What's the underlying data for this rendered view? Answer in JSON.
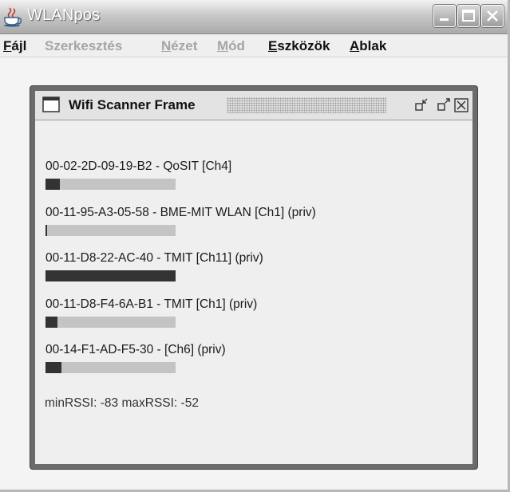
{
  "app": {
    "title": "WLANpos",
    "icon": "coffee-cup-icon",
    "window_buttons": [
      "minimize-icon",
      "maximize-icon",
      "close-icon"
    ]
  },
  "menu": [
    {
      "mnemonic": "F",
      "rest": "ájl",
      "enabled": true
    },
    {
      "mnemonic": "",
      "rest": "Szerkesztés",
      "enabled": false
    },
    {
      "mnemonic": "N",
      "rest": "ézet",
      "enabled": false
    },
    {
      "mnemonic": "M",
      "rest": "ód",
      "enabled": false
    },
    {
      "mnemonic": "E",
      "rest": "szközök",
      "enabled": true
    },
    {
      "mnemonic": "A",
      "rest": "blak",
      "enabled": true
    }
  ],
  "frame": {
    "title": "Wifi Scanner Frame",
    "controls": [
      "iconify-icon",
      "maximize-icon",
      "close-icon"
    ]
  },
  "networks": [
    {
      "label": "00-02-2D-09-19-B2 - QoSIT [Ch4]",
      "signal_fraction": 0.11
    },
    {
      "label": "00-11-95-A3-05-58 - BME-MIT WLAN [Ch1] (priv)",
      "signal_fraction": 0.01
    },
    {
      "label": "00-11-D8-22-AC-40 - TMIT [Ch11] (priv)",
      "signal_fraction": 1.0
    },
    {
      "label": "00-11-D8-F4-6A-B1 - TMIT [Ch1] (priv)",
      "signal_fraction": 0.09
    },
    {
      "label": "00-14-F1-AD-F5-30 -  [Ch6] (priv)",
      "signal_fraction": 0.12
    }
  ],
  "rssi_summary": "minRSSI: -83  maxRSSI: -52",
  "colors": {
    "signal_bar": "#333333",
    "bar_track": "#c4c4c4"
  }
}
